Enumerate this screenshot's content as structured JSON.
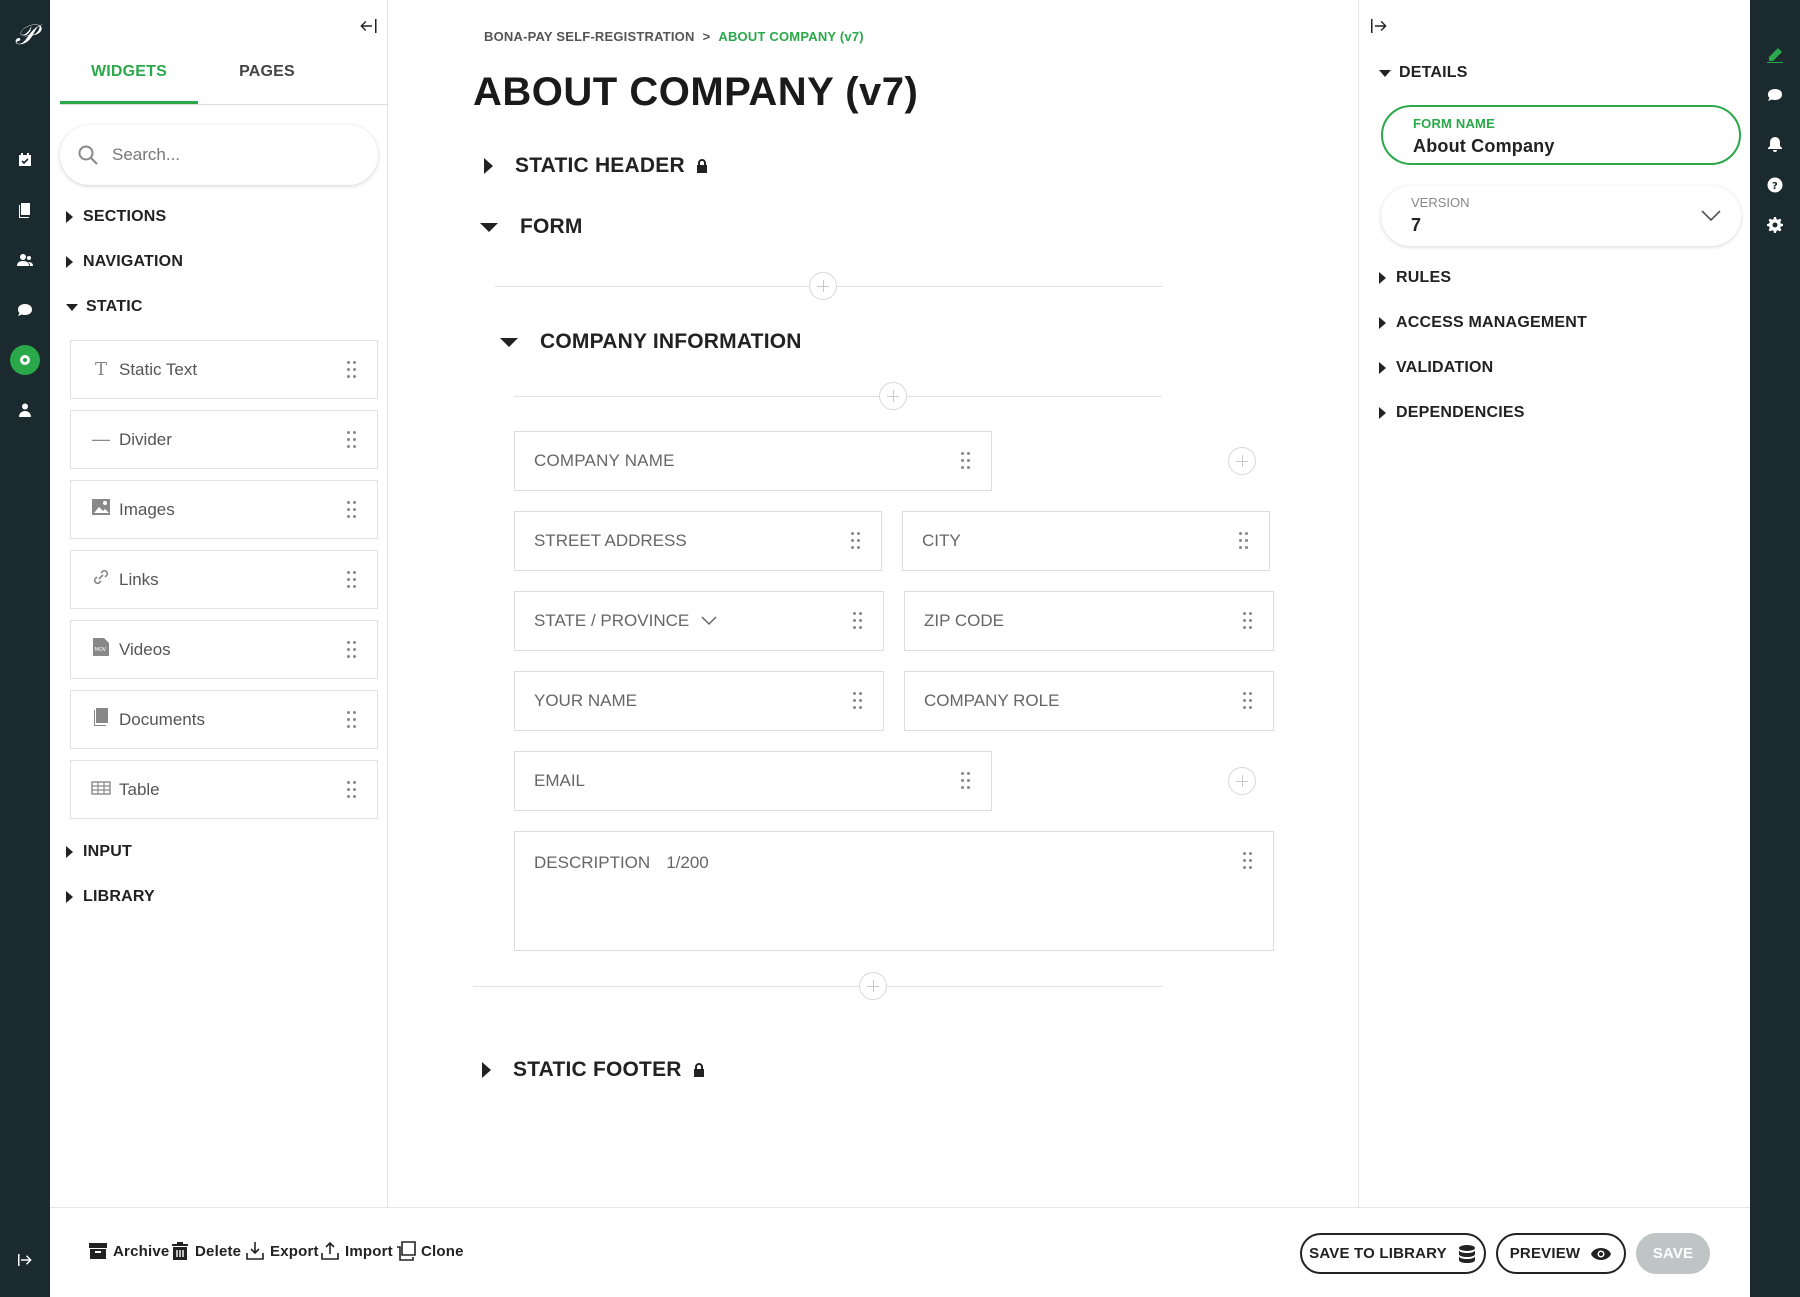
{
  "left_panel": {
    "tabs": [
      {
        "label": "WIDGETS"
      },
      {
        "label": "PAGES"
      }
    ],
    "search": {
      "placeholder": "Search..."
    },
    "groups": {
      "sections": "SECTIONS",
      "navigation": "NAVIGATION",
      "static": "STATIC",
      "input": "INPUT",
      "library": "LIBRARY"
    },
    "static_widgets": [
      {
        "label": "Static Text",
        "icon": "text-icon"
      },
      {
        "label": "Divider",
        "icon": "divider-icon"
      },
      {
        "label": "Images",
        "icon": "image-icon"
      },
      {
        "label": "Links",
        "icon": "link-icon"
      },
      {
        "label": "Videos",
        "icon": "video-icon"
      },
      {
        "label": "Documents",
        "icon": "document-icon"
      },
      {
        "label": "Table",
        "icon": "table-icon"
      }
    ]
  },
  "breadcrumb": {
    "parent": "BONA-PAY SELF-REGISTRATION",
    "separator": ">",
    "current": "ABOUT COMPANY (v7)"
  },
  "page_title": "ABOUT COMPANY (v7)",
  "sections": {
    "static_header": "STATIC HEADER",
    "form": "FORM",
    "company_information": "COMPANY INFORMATION",
    "static_footer": "STATIC FOOTER"
  },
  "fields": {
    "company_name": "COMPANY NAME",
    "street_address": "STREET ADDRESS",
    "city": "CITY",
    "state_province": "STATE / PROVINCE",
    "zip_code": "ZIP CODE",
    "your_name": "YOUR NAME",
    "company_role": "COMPANY ROLE",
    "email": "EMAIL",
    "description": "DESCRIPTION",
    "description_counter": "1/200"
  },
  "right_panel": {
    "details": "DETAILS",
    "form_name_label": "FORM NAME",
    "form_name_value": "About Company",
    "version_label": "VERSION",
    "version_value": "7",
    "groups": {
      "rules": "RULES",
      "access_management": "ACCESS MANAGEMENT",
      "validation": "VALIDATION",
      "dependencies": "DEPENDENCIES"
    }
  },
  "bottom_bar": {
    "archive": "Archive",
    "delete": "Delete",
    "export": "Export",
    "import": "Import",
    "clone": "Clone",
    "save_to_library": "SAVE TO LIBRARY",
    "preview": "PREVIEW",
    "save": "SAVE"
  },
  "colors": {
    "accent": "#2aa84a",
    "rail": "#1a2a2f",
    "disabled": "#bfc4c5"
  }
}
